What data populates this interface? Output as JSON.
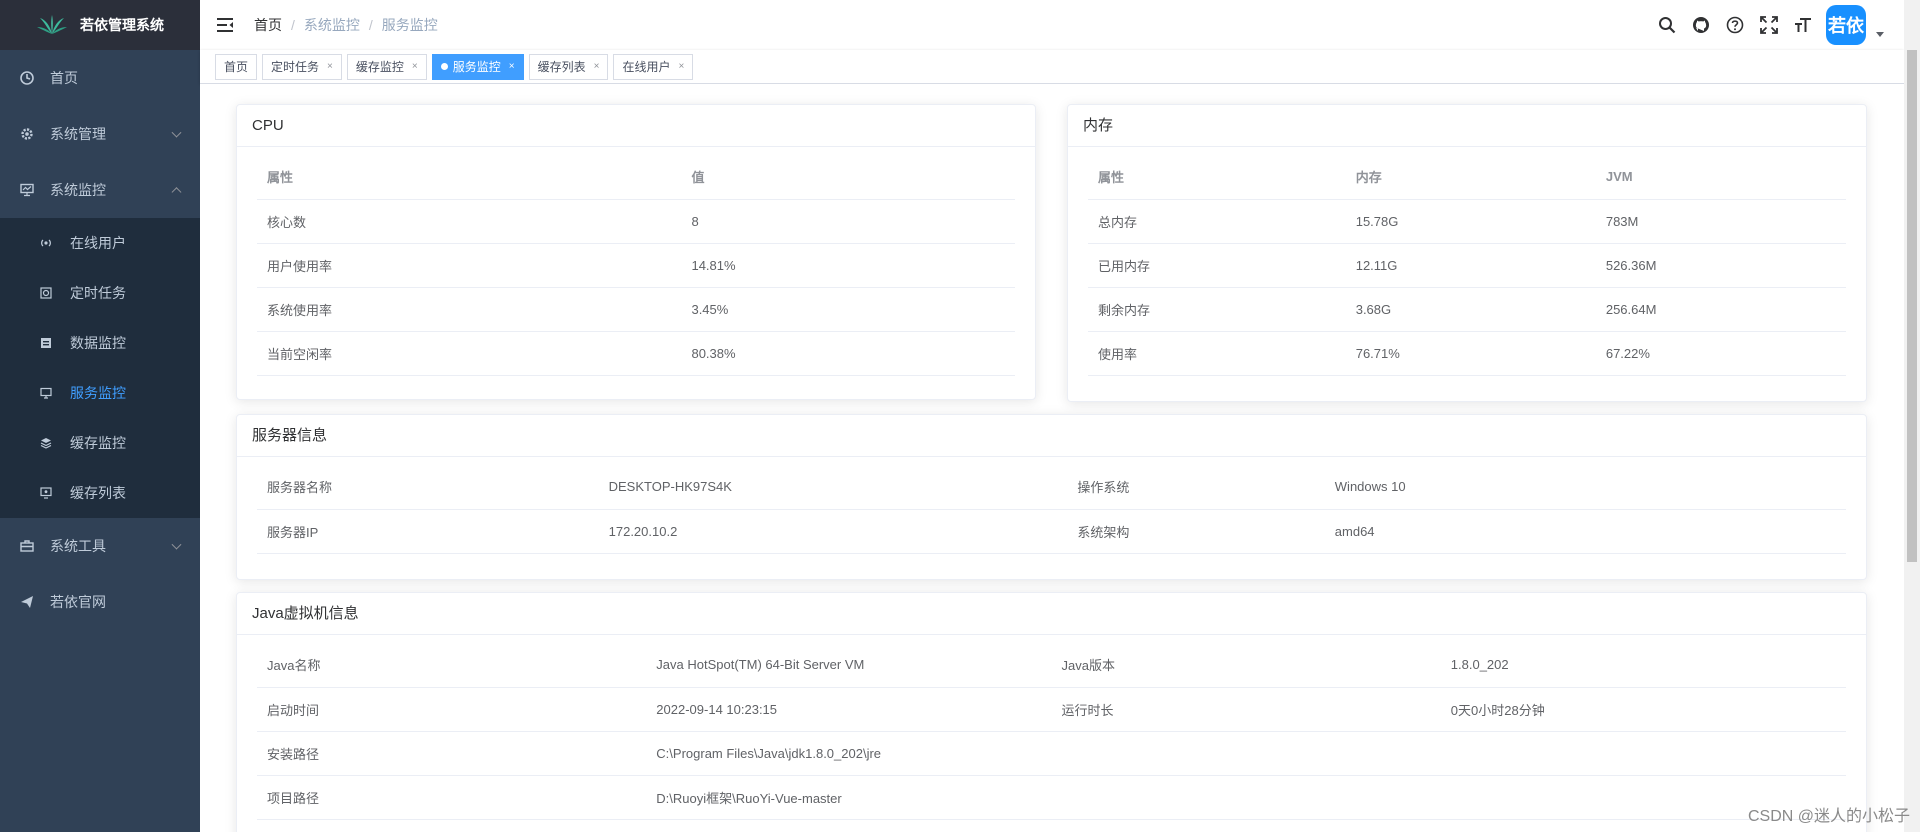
{
  "app": {
    "title": "若依管理系统",
    "colors": {
      "sidebar_bg": "#304156",
      "active": "#409eff"
    }
  },
  "sidebar": {
    "items": [
      {
        "label": "首页",
        "icon": "dashboard-icon"
      },
      {
        "label": "系统管理",
        "icon": "gear-icon"
      },
      {
        "label": "系统监控",
        "icon": "monitor-icon"
      }
    ],
    "monitor_children": [
      {
        "label": "在线用户",
        "icon": "online-icon"
      },
      {
        "label": "定时任务",
        "icon": "job-icon"
      },
      {
        "label": "数据监控",
        "icon": "druid-icon"
      },
      {
        "label": "服务监控",
        "icon": "server-icon"
      },
      {
        "label": "缓存监控",
        "icon": "redis-icon"
      },
      {
        "label": "缓存列表",
        "icon": "redis-list-icon"
      }
    ],
    "items_after": [
      {
        "label": "系统工具",
        "icon": "tool-icon"
      },
      {
        "label": "若依官网",
        "icon": "guide-icon"
      }
    ]
  },
  "breadcrumb": [
    "首页",
    "系统监控",
    "服务监控"
  ],
  "breadcrumb_sep": "/",
  "avatar_text": "若依",
  "tags": [
    {
      "label": "首页",
      "closable": false
    },
    {
      "label": "定时任务",
      "closable": true
    },
    {
      "label": "缓存监控",
      "closable": true
    },
    {
      "label": "服务监控",
      "closable": true,
      "active": true
    },
    {
      "label": "缓存列表",
      "closable": true
    },
    {
      "label": "在线用户",
      "closable": true
    }
  ],
  "close_glyph": "×",
  "cpu": {
    "title": "CPU",
    "headers": [
      "属性",
      "值"
    ],
    "rows": [
      [
        "核心数",
        "8"
      ],
      [
        "用户使用率",
        "14.81%"
      ],
      [
        "系统使用率",
        "3.45%"
      ],
      [
        "当前空闲率",
        "80.38%"
      ]
    ]
  },
  "mem": {
    "title": "内存",
    "headers": [
      "属性",
      "内存",
      "JVM"
    ],
    "rows": [
      [
        "总内存",
        "15.78G",
        "783M"
      ],
      [
        "已用内存",
        "12.11G",
        "526.36M"
      ],
      [
        "剩余内存",
        "3.68G",
        "256.64M"
      ],
      [
        "使用率",
        "76.71%",
        "67.22%"
      ]
    ]
  },
  "server": {
    "title": "服务器信息",
    "rows": [
      [
        "服务器名称",
        "DESKTOP-HK97S4K",
        "操作系统",
        "Windows 10"
      ],
      [
        "服务器IP",
        "172.20.10.2",
        "系统架构",
        "amd64"
      ]
    ]
  },
  "jvm": {
    "title": "Java虚拟机信息",
    "rows": [
      [
        "Java名称",
        "Java HotSpot(TM) 64-Bit Server VM",
        "Java版本",
        "1.8.0_202"
      ],
      [
        "启动时间",
        "2022-09-14 10:23:15",
        "运行时长",
        "0天0小时28分钟"
      ],
      [
        "安装路径",
        "C:\\Program Files\\Java\\jdk1.8.0_202\\jre",
        "",
        ""
      ],
      [
        "项目路径",
        "D:\\Ruoyi框架\\RuoYi-Vue-master",
        "",
        ""
      ]
    ]
  },
  "watermark": "CSDN @迷人的小松子"
}
